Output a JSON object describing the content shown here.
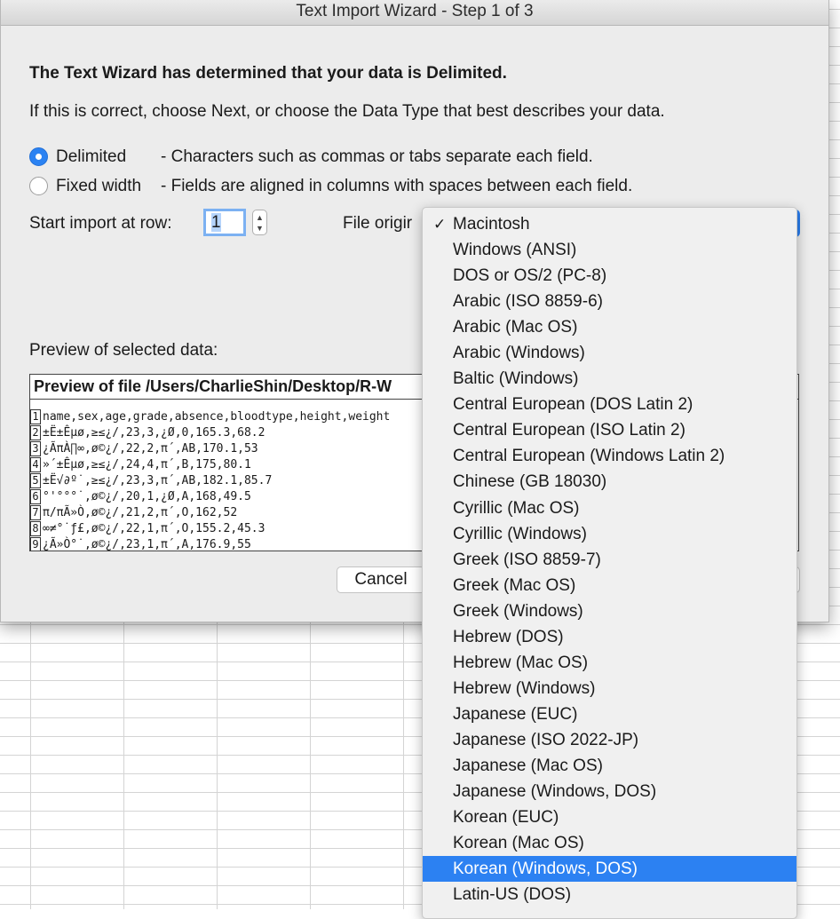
{
  "window": {
    "title": "Text Import Wizard - Step 1 of 3"
  },
  "headline": "The Text Wizard has determined that your data is Delimited.",
  "subline": "If this is correct, choose Next, or choose the Data Type that best describes your data.",
  "data_type": {
    "delimited": {
      "label": "Delimited",
      "desc": "- Characters such as commas or tabs separate each field.",
      "selected": true
    },
    "fixed_width": {
      "label": "Fixed width",
      "desc": "- Fields are aligned in columns with spaces between each field.",
      "selected": false
    }
  },
  "start_row": {
    "label": "Start import at row:",
    "value": "1"
  },
  "file_origin": {
    "label": "File origin",
    "label_visible": "File origir"
  },
  "preview": {
    "label": "Preview of selected data:",
    "title": "Preview of file /Users/CharlieShin/Desktop/R-W",
    "lines": [
      {
        "num": "1",
        "text": "name,sex,age,grade,absence,bloodtype,height,weight"
      },
      {
        "num": "2",
        "text": "±Ë±Êµø,≥≤¿/,23,3,¿Ø,0,165.3,68.2"
      },
      {
        "num": "3",
        "text": "¿ÃπÀ∏∞,ø©¿/,22,2,π´,AB,170.1,53"
      },
      {
        "num": "4",
        "text": "»´±Êµø,≥≤¿/,24,4,π´,B,175,80.1"
      },
      {
        "num": "5",
        "text": "±Ë√∂º˙,≥≤¿/,23,3,π´,AB,182.1,85.7"
      },
      {
        "num": "6",
        "text": "°'°°°˙,ø©¿/,20,1,¿Ø,A,168,49.5"
      },
      {
        "num": "7",
        "text": "π/πÃ»Ò,ø©¿/,21,2,π´,O,162,52"
      },
      {
        "num": "8",
        "text": "∞≠°˙ƒ£,ø©¿/,22,1,π´,O,155.2,45.3"
      },
      {
        "num": "9",
        "text": "¿Ã»Ò°˙,ø©¿/,23,1,π´,A,176.9,55"
      }
    ]
  },
  "buttons": {
    "cancel": "Cancel"
  },
  "dropdown": {
    "checked": "Macintosh",
    "checkmark": "✓",
    "highlighted": "Korean (Windows, DOS)",
    "options": [
      "Macintosh",
      "Windows (ANSI)",
      "DOS or OS/2 (PC-8)",
      "Arabic (ISO 8859-6)",
      "Arabic (Mac OS)",
      "Arabic (Windows)",
      "Baltic (Windows)",
      "Central European (DOS Latin 2)",
      "Central European (ISO Latin 2)",
      "Central European (Windows Latin 2)",
      "Chinese (GB 18030)",
      "Cyrillic (Mac OS)",
      "Cyrillic (Windows)",
      "Greek (ISO 8859-7)",
      "Greek (Mac OS)",
      "Greek (Windows)",
      "Hebrew (DOS)",
      "Hebrew (Mac OS)",
      "Hebrew (Windows)",
      "Japanese (EUC)",
      "Japanese (ISO 2022-JP)",
      "Japanese (Mac OS)",
      "Japanese (Windows, DOS)",
      "Korean (EUC)",
      "Korean (Mac OS)",
      "Korean (Windows, DOS)",
      "Latin-US (DOS)"
    ]
  },
  "colors": {
    "accent": "#2c81f2",
    "dialog_bg": "#ececec",
    "menu_bg": "#f0f0f0"
  }
}
